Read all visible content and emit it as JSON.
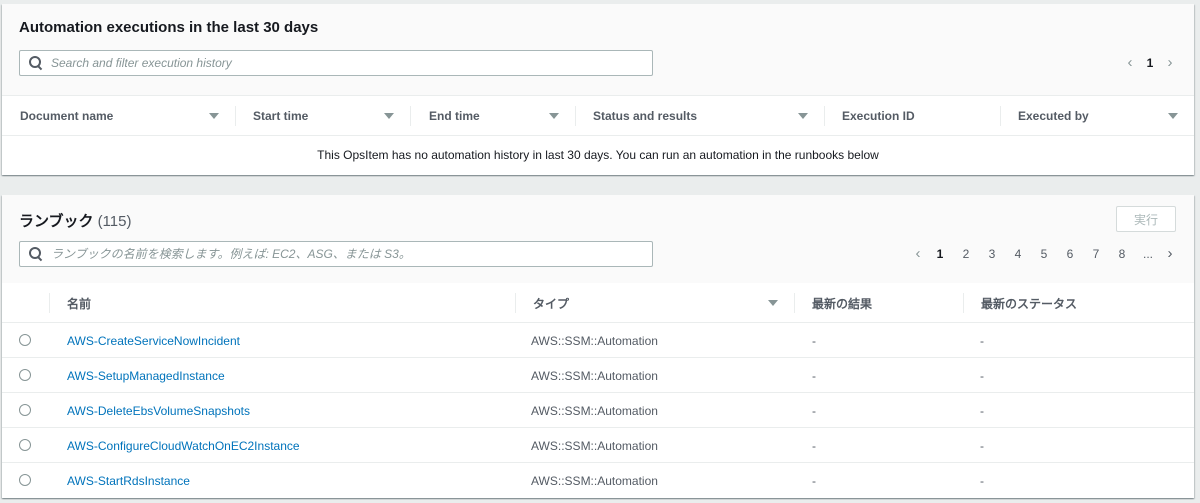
{
  "executions": {
    "title": "Automation executions in the last 30 days",
    "search_placeholder": "Search and filter execution history",
    "pagination": {
      "current_page": "1",
      "prev": "‹",
      "next": "›"
    },
    "columns": [
      "Document name",
      "Start time",
      "End time",
      "Status and results",
      "Execution ID",
      "Executed by"
    ],
    "empty_message": "This OpsItem has no automation history in last 30 days. You can run an automation in the runbooks below"
  },
  "runbooks": {
    "title": "ランブック",
    "count": "(115)",
    "run_button": "実行",
    "search_placeholder": "ランブックの名前を検索します。例えば: EC2、ASG、または S3。",
    "pagination": {
      "prev": "‹",
      "next": "›",
      "pages": [
        "1",
        "2",
        "3",
        "4",
        "5",
        "6",
        "7",
        "8",
        "..."
      ],
      "current_page": "1"
    },
    "columns": [
      "名前",
      "タイプ",
      "最新の結果",
      "最新のステータス"
    ],
    "rows": [
      {
        "name": "AWS-CreateServiceNowIncident",
        "type": "AWS::SSM::Automation",
        "latest_result": "-",
        "latest_status": "-"
      },
      {
        "name": "AWS-SetupManagedInstance",
        "type": "AWS::SSM::Automation",
        "latest_result": "-",
        "latest_status": "-"
      },
      {
        "name": "AWS-DeleteEbsVolumeSnapshots",
        "type": "AWS::SSM::Automation",
        "latest_result": "-",
        "latest_status": "-"
      },
      {
        "name": "AWS-ConfigureCloudWatchOnEC2Instance",
        "type": "AWS::SSM::Automation",
        "latest_result": "-",
        "latest_status": "-"
      },
      {
        "name": "AWS-StartRdsInstance",
        "type": "AWS::SSM::Automation",
        "latest_result": "-",
        "latest_status": "-"
      }
    ]
  },
  "colors": {
    "link": "#0073bb",
    "background": "#eaeded",
    "header_bg": "#fafafa"
  }
}
